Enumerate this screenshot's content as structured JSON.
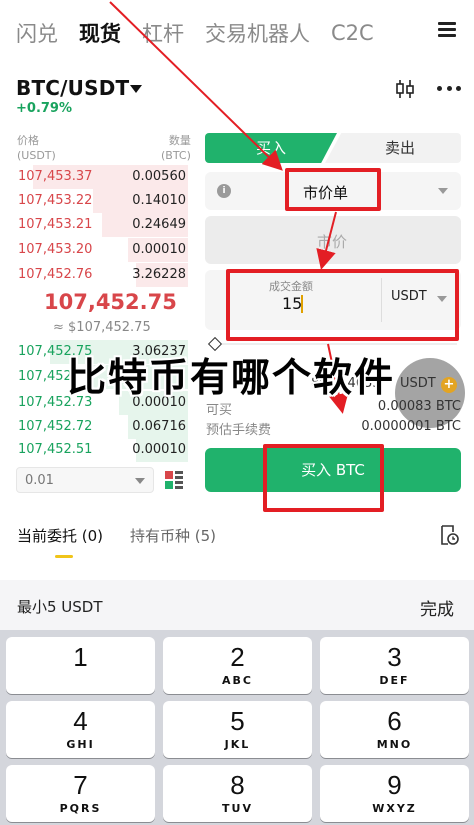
{
  "nav": {
    "tabs": [
      "闪兑",
      "现货",
      "杠杆",
      "交易机器人",
      "C2C"
    ],
    "active_index": 1
  },
  "pair": {
    "symbol": "BTC/USDT",
    "change": "+0.79%"
  },
  "orderbook": {
    "price_header": "价格",
    "price_unit": "(USDT)",
    "qty_header": "数量",
    "qty_unit": "(BTC)",
    "asks": [
      {
        "price": "107,453.37",
        "qty": "0.00560",
        "depth": 0.9
      },
      {
        "price": "107,453.22",
        "qty": "0.14010",
        "depth": 0.55
      },
      {
        "price": "107,453.21",
        "qty": "0.24649",
        "depth": 0.5
      },
      {
        "price": "107,453.20",
        "qty": "0.00010",
        "depth": 0.35
      },
      {
        "price": "107,452.76",
        "qty": "3.26228",
        "depth": 0.3
      }
    ],
    "mid_price": "107,452.75",
    "mid_usd": "≈ $107,452.75",
    "bids": [
      {
        "price": "107,452.75",
        "qty": "3.06237",
        "depth": 0.8
      },
      {
        "price": "107,452",
        "qty": "",
        "depth": 0.55
      },
      {
        "price": "107,452.73",
        "qty": "0.00010",
        "depth": 0.4
      },
      {
        "price": "107,452.72",
        "qty": "0.06716",
        "depth": 0.35
      },
      {
        "price": "107,452.51",
        "qty": "0.00010",
        "depth": 0.3
      }
    ],
    "depth_value": "0.01"
  },
  "form": {
    "buy_tab": "买入",
    "sell_tab": "卖出",
    "order_type": "市价单",
    "price_placeholder": "市价",
    "amount_label": "成交金额",
    "amount_value": "15",
    "amount_unit": "USDT",
    "available_partial": "89",
    "available_middle": "4653",
    "available_unit": "USDT",
    "can_buy_label": "可买",
    "can_buy_value": "0.00083 BTC",
    "fee_label": "预估手续费",
    "fee_value": "0.0000001 BTC",
    "submit": "买入 BTC"
  },
  "bottom_tabs": {
    "open_orders": "当前委托 (0)",
    "holdings": "持有币种 (5)"
  },
  "keyboard": {
    "hint": "最小5 USDT",
    "done": "完成",
    "keys": [
      {
        "num": "1",
        "letters": ""
      },
      {
        "num": "2",
        "letters": "ABC"
      },
      {
        "num": "3",
        "letters": "DEF"
      },
      {
        "num": "4",
        "letters": "GHI"
      },
      {
        "num": "5",
        "letters": "JKL"
      },
      {
        "num": "6",
        "letters": "MNO"
      },
      {
        "num": "7",
        "letters": "PQRS"
      },
      {
        "num": "8",
        "letters": "TUV"
      },
      {
        "num": "9",
        "letters": "WXYZ"
      }
    ]
  },
  "overlay": {
    "title": "比特币有哪个软件"
  },
  "colors": {
    "green": "#20b26c",
    "red": "#d8464a",
    "annotation": "#e31e24",
    "accent": "#f0c419"
  }
}
